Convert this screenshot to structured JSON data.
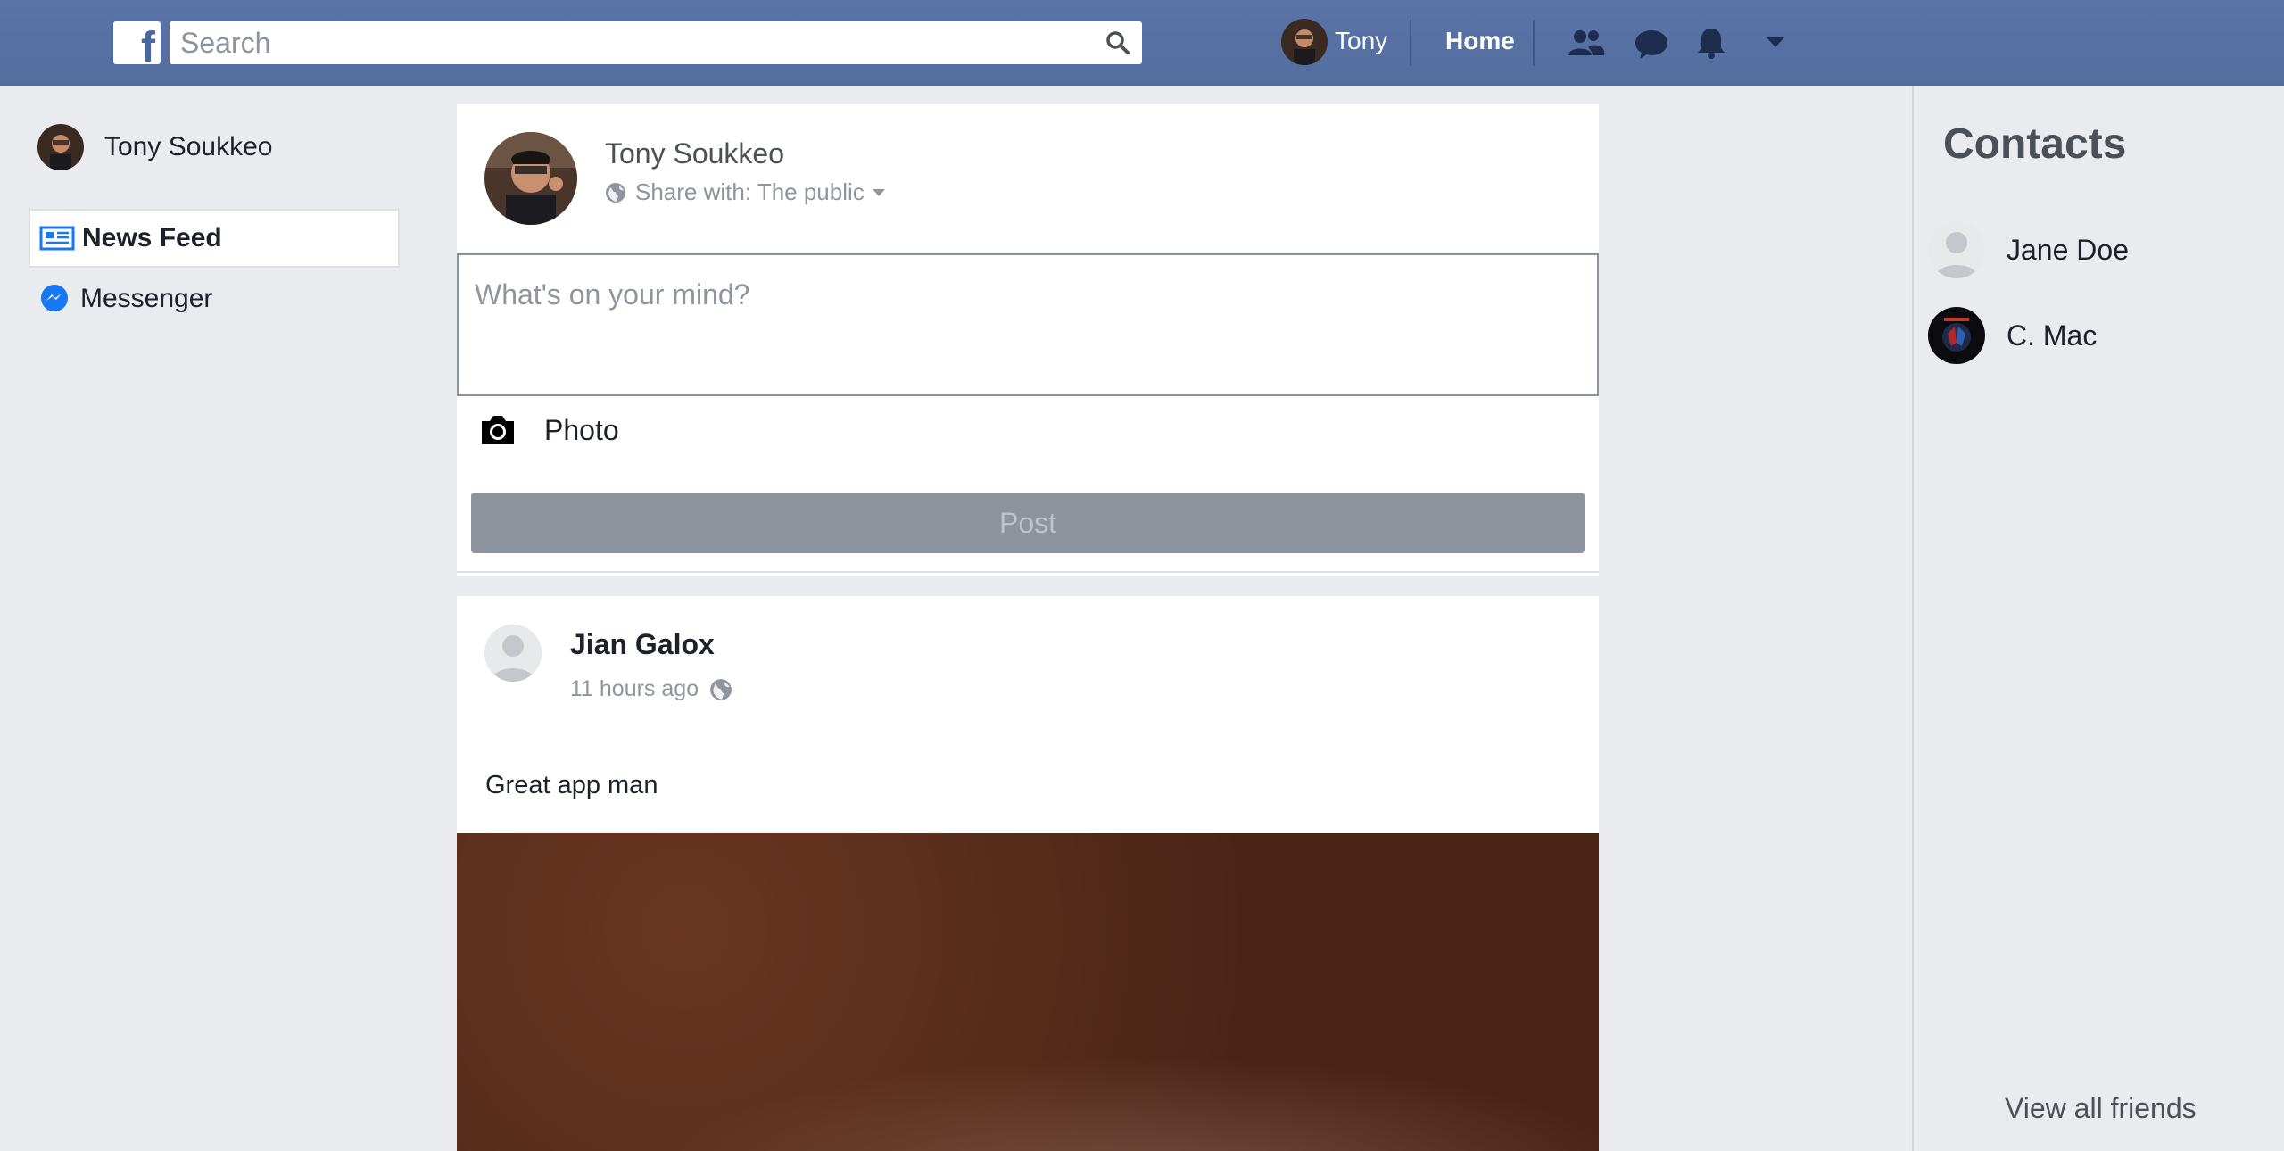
{
  "header": {
    "logo_letter": "f",
    "search_placeholder": "Search",
    "user_name": "Tony",
    "home_label": "Home",
    "icons": [
      "friends-icon",
      "messages-icon",
      "notifications-icon",
      "account-menu-caret-icon"
    ]
  },
  "sidebar": {
    "profile_name": "Tony Soukkeo",
    "items": [
      {
        "label": "News Feed",
        "icon": "news-feed-icon",
        "active": true
      },
      {
        "label": "Messenger",
        "icon": "messenger-icon",
        "active": false
      }
    ]
  },
  "composer": {
    "author_name": "Tony Soukkeo",
    "share_label": "Share with: The public",
    "placeholder": "What's on your mind?",
    "photo_label": "Photo",
    "post_label": "Post"
  },
  "feed": {
    "posts": [
      {
        "author": "Jian Galox",
        "time": "11 hours ago",
        "text": "Great app man"
      }
    ]
  },
  "contacts": {
    "title": "Contacts",
    "items": [
      {
        "name": "Jane Doe"
      },
      {
        "name": "C. Mac"
      }
    ],
    "view_all_label": "View all friends"
  },
  "colors": {
    "brand": "#4b67a1",
    "background": "#e9ebee",
    "post_button_disabled": "#8d949e"
  }
}
